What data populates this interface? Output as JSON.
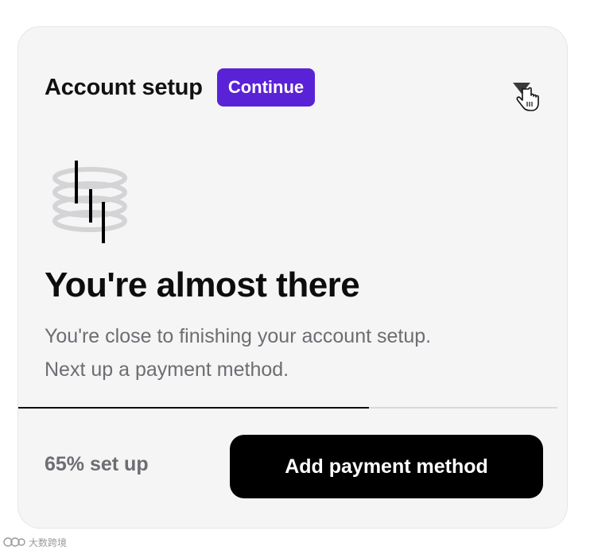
{
  "card": {
    "title": "Account setup",
    "continue_label": "Continue",
    "headline": "You're almost there",
    "description_lines": [
      "You're close to finishing your account setup.",
      "Next up a payment method."
    ],
    "progress": {
      "fraction": 0.65,
      "label": "65% set up"
    },
    "primary_action_label": "Add payment method",
    "menu_icon": "chevron-down-icon"
  },
  "colors": {
    "accent": "#5a22d6",
    "primary_button": "#000000",
    "card_background": "#f5f5f6",
    "muted_text": "#6d6d72"
  },
  "watermark": {
    "text": "大数跨境"
  }
}
